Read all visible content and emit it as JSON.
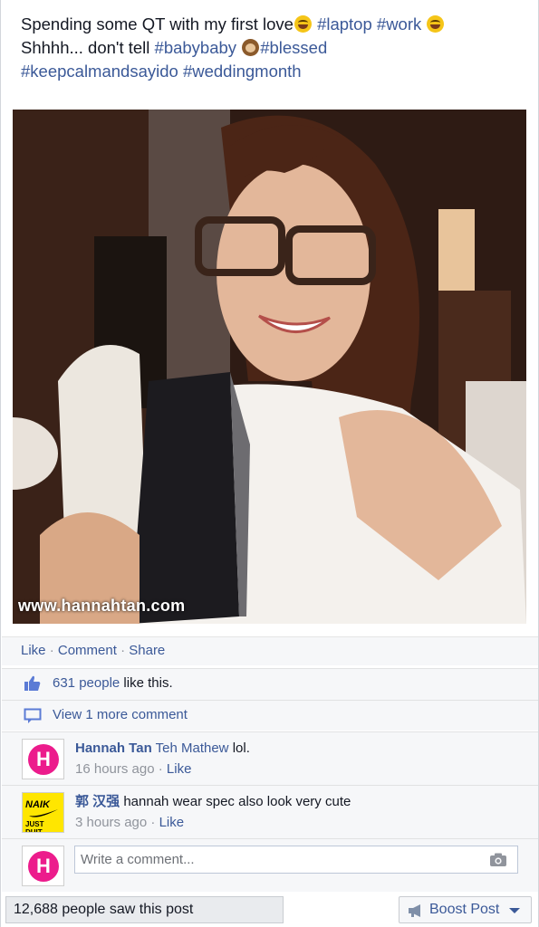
{
  "post": {
    "caption": {
      "line1_text": "Spending some QT with my first love",
      "line1_emoji": "grinning-face-emoji",
      "tag_laptop": "#laptop",
      "tag_work": "#work",
      "line1_emoji_end": "grinning-face-emoji",
      "line2_text": "Shhhh... don't tell",
      "tag_babybaby": "#babybaby",
      "line2_emoji": "see-no-evil-monkey-emoji",
      "tag_blessed": "#blessed",
      "tag_keepcalm": "#keepcalmandsayido",
      "tag_wedding": "#weddingmonth"
    },
    "photo": {
      "watermark": "www.hannahtan.com",
      "icon": "photo-selfie-woman-with-laptop"
    }
  },
  "actions": {
    "like": "Like",
    "comment": "Comment",
    "share": "Share",
    "separator": "·"
  },
  "likes": {
    "icon": "thumbs-up-icon",
    "count_text": "631 people",
    "suffix": "like this."
  },
  "more_comments": {
    "icon": "comment-bubble-icon",
    "label": "View 1 more comment"
  },
  "comments": [
    {
      "author": "Hannah Tan",
      "mention": "Teh Mathew",
      "text": "lol.",
      "time": "16 hours ago",
      "like": "Like",
      "avatar": "hannah-tan-avatar"
    },
    {
      "author": "郭 汉强",
      "text": "hannah wear spec also look very cute",
      "time": "3 hours ago",
      "like": "Like",
      "avatar": "nike-parody-avatar",
      "avatar_text_top": "NAIK",
      "avatar_text_bottom": "JUST DUIT."
    }
  ],
  "composer": {
    "avatar": "hannah-tan-avatar",
    "avatar_letter": "H",
    "placeholder": "Write a comment...",
    "camera_icon": "camera-icon"
  },
  "footer": {
    "reach": "12,688 people saw this post",
    "boost_label": "Boost Post",
    "boost_icon": "megaphone-icon"
  },
  "colors": {
    "link": "#3b5998",
    "avatar_pink": "#ec1c8c",
    "nike_yellow": "#ffe600",
    "band_bg": "#f6f7f9"
  }
}
